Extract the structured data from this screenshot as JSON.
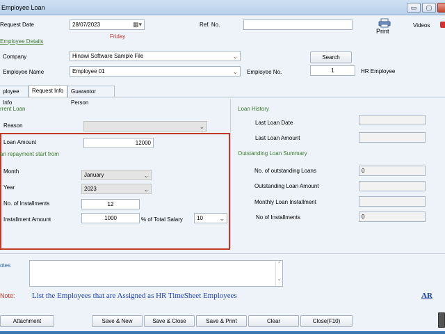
{
  "window": {
    "title": "Employee Loan",
    "minimize": "▭",
    "maximize": "▢",
    "close": "✕"
  },
  "header": {
    "request_date_label": "Request Date",
    "request_date_value": "28/07/2023",
    "day_name": "Friday",
    "ref_no_label": "Ref. No.",
    "ref_no_value": "",
    "print_label": "Print",
    "videos_label": "Videos",
    "employee_details_link": "Employee Details",
    "company_label": "Company",
    "company_value": "Hinawi Software Sample File",
    "search_label": "Search",
    "employee_name_label": "Employee Name",
    "employee_name_value": "Employee 01",
    "employee_no_label": "Employee No.",
    "employee_no_value": "1",
    "hr_employee_label": "HR Employee"
  },
  "tabs": [
    {
      "label": "ployee Info"
    },
    {
      "label": "Request Info"
    },
    {
      "label": "Guarantor Person"
    }
  ],
  "left": {
    "current_loan_label": "rrent Loan",
    "reason_label": "Reason",
    "reason_value": "",
    "loan_amount_label": "Loan Amount",
    "loan_amount_value": "12000",
    "repayment_start_label": "an repayment start from",
    "month_label": "Month",
    "month_value": "January",
    "year_label": "Year",
    "year_value": "2023",
    "installments_label": "No. of Installments",
    "installments_value": "12",
    "installment_amount_label": "Installment Amount",
    "installment_amount_value": "1000",
    "pct_total_salary_label": "% of Total Salary",
    "pct_value": "10"
  },
  "right": {
    "loan_history_label": "Loan History",
    "last_loan_date_label": "Last Loan Date",
    "last_loan_date_value": "",
    "last_loan_amount_label": "Last Loan Amount",
    "last_loan_amount_value": "",
    "outstanding_summary_label": "Outstanding Loan Summary",
    "outstanding_loans_label": "No. of outstanding Loans",
    "outstanding_loans_value": "0",
    "outstanding_amount_label": "Outstanding Loan Amount",
    "outstanding_amount_value": "",
    "monthly_installment_label": "Monthly Loan Installment",
    "monthly_installment_value": "",
    "no_installments_label": "No of Installments",
    "no_installments_value": "0"
  },
  "notes": {
    "notes_label": "otes",
    "notes_value": "",
    "note_label": "Note:",
    "note_text": "List the Employees that are Assigned as HR  TimeSheet Employees",
    "ar_link": "AR"
  },
  "buttons": {
    "attachment": "Attachment",
    "save_new": "Save & New",
    "save_close": "Save & Close",
    "save_print": "Save & Print",
    "clear": "Clear",
    "close": "Close(F10)"
  },
  "icons": {
    "calendar": "calendar-icon",
    "dropdown": "chevron-down-icon",
    "print": "printer-icon",
    "calculator": "calculator-icon"
  }
}
